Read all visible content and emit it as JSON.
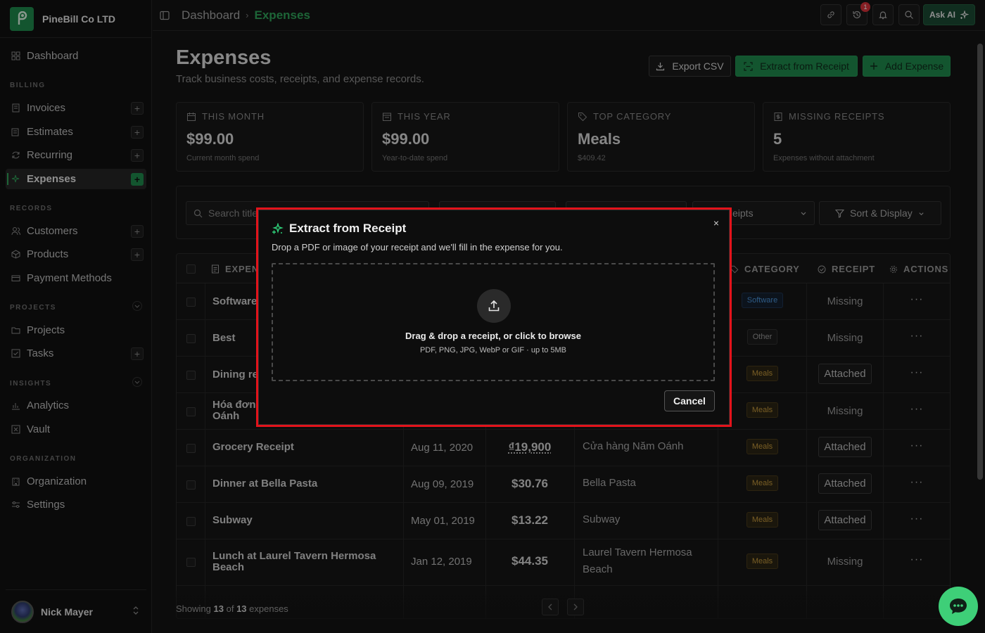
{
  "brand": {
    "name": "PineBill Co LTD"
  },
  "sidebar": {
    "dashboard": "Dashboard",
    "sections": [
      "BILLING",
      "RECORDS",
      "PROJECTS",
      "INSIGHTS",
      "ORGANIZATION"
    ],
    "items": {
      "invoices": "Invoices",
      "estimates": "Estimates",
      "recurring": "Recurring",
      "expenses": "Expenses",
      "customers": "Customers",
      "products": "Products",
      "payment_methods": "Payment Methods",
      "projects": "Projects",
      "tasks": "Tasks",
      "analytics": "Analytics",
      "vault": "Vault",
      "organization": "Organization",
      "settings": "Settings"
    },
    "user": "Nick Mayer"
  },
  "topbar": {
    "breadcrumb_root": "Dashboard",
    "breadcrumb_sep": "›",
    "breadcrumb_current": "Expenses",
    "notification_count": "1",
    "ask_ai": "Ask AI"
  },
  "page": {
    "title": "Expenses",
    "subtitle": "Track business costs, receipts, and expense records.",
    "export_csv": "Export CSV",
    "extract": "Extract from Receipt",
    "add_expense": "Add Expense"
  },
  "stats": [
    {
      "label": "THIS MONTH",
      "value": "$99.00",
      "sub": "Current month spend"
    },
    {
      "label": "THIS YEAR",
      "value": "$99.00",
      "sub": "Year-to-date spend"
    },
    {
      "label": "TOP CATEGORY",
      "value": "Meals",
      "sub": "$409.42"
    },
    {
      "label": "MISSING RECEIPTS",
      "value": "5",
      "sub": "Expenses without attachment"
    }
  ],
  "filters": {
    "search_placeholder": "Search title",
    "receipts_select": "eipts",
    "sort_display": "Sort & Display"
  },
  "table": {
    "headers": {
      "expense": "EXPEN",
      "category": "CATEGORY",
      "receipt": "RECEIPT",
      "actions": "ACTIONS"
    },
    "rows": [
      {
        "title": "Software",
        "date": "",
        "amount": "",
        "vendor": "",
        "category": "Software",
        "receipt": "Missing"
      },
      {
        "title": "Best",
        "date": "",
        "amount": "",
        "vendor": "",
        "category": "Other",
        "receipt": "Missing"
      },
      {
        "title": "Dining re",
        "date": "",
        "amount": "",
        "vendor": "",
        "category": "Meals",
        "receipt": "Attached"
      },
      {
        "title": "Hóa đơn Oánh",
        "date": "",
        "amount": "",
        "vendor": "",
        "category": "Meals",
        "receipt": "Missing"
      },
      {
        "title": "Grocery Receipt",
        "date": "Aug 11, 2020",
        "amount": "₫19,900",
        "vendor": "Cửa hàng Năm Oánh",
        "category": "Meals",
        "receipt": "Attached"
      },
      {
        "title": "Dinner at Bella Pasta",
        "date": "Aug 09, 2019",
        "amount": "$30.76",
        "vendor": "Bella Pasta",
        "category": "Meals",
        "receipt": "Attached"
      },
      {
        "title": "Subway",
        "date": "May 01, 2019",
        "amount": "$13.22",
        "vendor": "Subway",
        "category": "Meals",
        "receipt": "Attached"
      },
      {
        "title": "Lunch at Laurel Tavern Hermosa Beach",
        "date": "Jan 12, 2019",
        "amount": "$44.35",
        "vendor": "Laurel Tavern Hermosa Beach",
        "category": "Meals",
        "receipt": "Missing"
      }
    ],
    "actions_glyph": "···"
  },
  "footer": {
    "prefix": "Showing",
    "shown": "13",
    "of": "of",
    "total": "13",
    "suffix": "expenses"
  },
  "modal": {
    "title": "Extract from Receipt",
    "description": "Drop a PDF or image of your receipt and we'll fill in the expense for you.",
    "drop_main": "Drag & drop a receipt, or click to browse",
    "drop_sub": "PDF, PNG, JPG, WebP or GIF · up to 5MB",
    "cancel": "Cancel",
    "close": "×"
  },
  "colors": {
    "accent": "#1f8a4c",
    "highlight": "#e3131b",
    "meals": "#c69a3c",
    "software": "#4b93d9"
  }
}
